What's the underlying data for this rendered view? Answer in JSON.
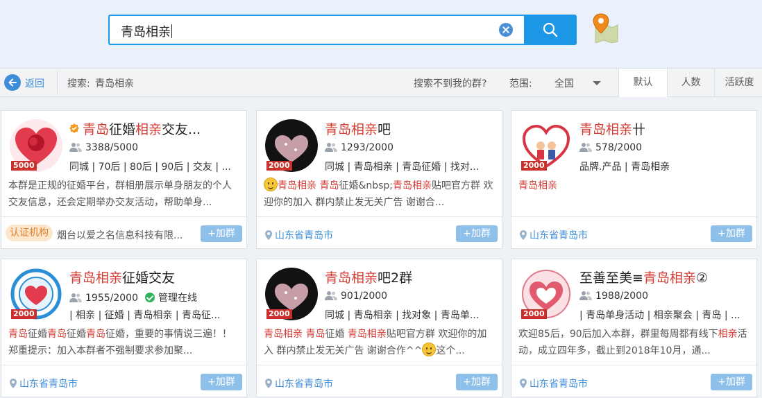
{
  "search": {
    "query": "青岛相亲"
  },
  "toolbar": {
    "back_label": "返回",
    "search_label": "搜索:",
    "search_value": "青岛相亲",
    "not_found": "搜索不到我的群?",
    "range_label": "范围:",
    "range_value": "全国",
    "sort_tabs": [
      "默认",
      "人数",
      "活跃度"
    ],
    "active_sort": "默认"
  },
  "colors": {
    "accent": "#1b97e5",
    "highlight": "#d43c33",
    "link": "#3d8ddb",
    "badge": "#c9302c",
    "join": "#8ec0ea"
  },
  "cards": [
    {
      "title_parts": [
        {
          "t": "青岛",
          "h": true
        },
        {
          "t": "征婚",
          "h": false
        },
        {
          "t": "相亲",
          "h": true
        },
        {
          "t": "交友...",
          "h": false
        }
      ],
      "verified": true,
      "badge": "5000",
      "members": "3388/5000",
      "online": "",
      "tags": "同城 | 70后 | 80后 | 90后 | 交友 | ...",
      "desc_parts": [
        {
          "t": "本群是正规的征婚平台，群相册展示单身朋友的个人交友信息，还会定期举办交友活动，帮助单身...",
          "h": false
        }
      ],
      "footer_type": "cert",
      "cert_label": "认证机构",
      "cert_org": "烟台以爱之名信息科技有限...",
      "location": "",
      "join_label": "+加群",
      "avatar": "rose-heart"
    },
    {
      "title_parts": [
        {
          "t": "青岛相亲",
          "h": true
        },
        {
          "t": "吧",
          "h": false
        }
      ],
      "verified": false,
      "badge": "2000",
      "members": "1293/2000",
      "online": "",
      "tags": "同城 | 青岛相亲 | 青岛征婚 | 找对...",
      "desc_emoji_start": true,
      "desc_parts": [
        {
          "t": "青岛相亲",
          "h": true
        },
        {
          "t": " ",
          "h": false
        },
        {
          "t": "青岛",
          "h": true
        },
        {
          "t": "征婚&nbsp;",
          "h": false
        },
        {
          "t": "青岛相亲",
          "h": true
        },
        {
          "t": "贴吧官方群 欢迎你的加入 群内禁止发无关广告 谢谢合...",
          "h": false
        }
      ],
      "footer_type": "location",
      "location": "山东省青岛市",
      "join_label": "+加群",
      "avatar": "dark-heart"
    },
    {
      "title_parts": [
        {
          "t": "青岛相亲",
          "h": true
        },
        {
          "t": "卄",
          "h": false
        }
      ],
      "verified": false,
      "badge": "2000",
      "members": "578/2000",
      "online": "",
      "tags": "品牌.产品 | 青岛相亲",
      "desc_parts": [
        {
          "t": "青岛相亲",
          "h": true
        }
      ],
      "footer_type": "location",
      "location": "山东省青岛市",
      "join_label": "+加群",
      "avatar": "couple-heart"
    },
    {
      "title_parts": [
        {
          "t": "青岛相亲",
          "h": true
        },
        {
          "t": "征婚交友",
          "h": false
        }
      ],
      "verified": false,
      "badge": "2000",
      "members": "1955/2000",
      "online": "管理在线",
      "tags": "| 相亲 | 征婚 | 青岛相亲 | 青岛征...",
      "desc_parts": [
        {
          "t": "青岛",
          "h": true
        },
        {
          "t": "征婚",
          "h": false
        },
        {
          "t": "青岛",
          "h": true
        },
        {
          "t": "征婚",
          "h": false
        },
        {
          "t": "青岛",
          "h": true
        },
        {
          "t": "征婚，重要的事情说三遍！！郑重提示：加入本群者不强制要求参加聚...",
          "h": false
        }
      ],
      "footer_type": "location",
      "location": "山东省青岛市",
      "join_label": "+加群",
      "avatar": "blue-circle"
    },
    {
      "title_parts": [
        {
          "t": "青岛相亲",
          "h": true
        },
        {
          "t": "吧2群",
          "h": false
        }
      ],
      "verified": false,
      "badge": "2000",
      "members": "901/2000",
      "online": "",
      "tags": "同城 | 青岛相亲 | 找对象 | 青岛单...",
      "desc_parts": [
        {
          "t": "青岛相亲",
          "h": true
        },
        {
          "t": " ",
          "h": false
        },
        {
          "t": "青岛",
          "h": true
        },
        {
          "t": "征婚 ",
          "h": false
        },
        {
          "t": "青岛相亲",
          "h": true
        },
        {
          "t": "贴吧官方群 欢迎你的加入 群内禁止发无关广告 谢谢合作^^",
          "h": false
        }
      ],
      "desc_emoji_end": true,
      "desc_tail": "这个...",
      "footer_type": "location",
      "location": "山东省青岛市",
      "join_label": "+加群",
      "avatar": "dark-heart"
    },
    {
      "title_parts": [
        {
          "t": "至善至美≡",
          "h": false
        },
        {
          "t": "青岛相亲",
          "h": true
        },
        {
          "t": "②",
          "h": false
        }
      ],
      "verified": false,
      "badge": "2000",
      "members": "1988/2000",
      "online": "",
      "tags": "| 青岛单身活动 | 相亲聚会 | 青岛 | ...",
      "desc_parts": [
        {
          "t": "欢迎85后，90后加入本群，群里每周都有线下",
          "h": false
        },
        {
          "t": "相亲",
          "h": true
        },
        {
          "t": "活动，成立四年多，截止到2018年10月，通...",
          "h": false
        }
      ],
      "footer_type": "location",
      "location": "山东省青岛市",
      "join_label": "+加群",
      "avatar": "pink-heart"
    }
  ]
}
